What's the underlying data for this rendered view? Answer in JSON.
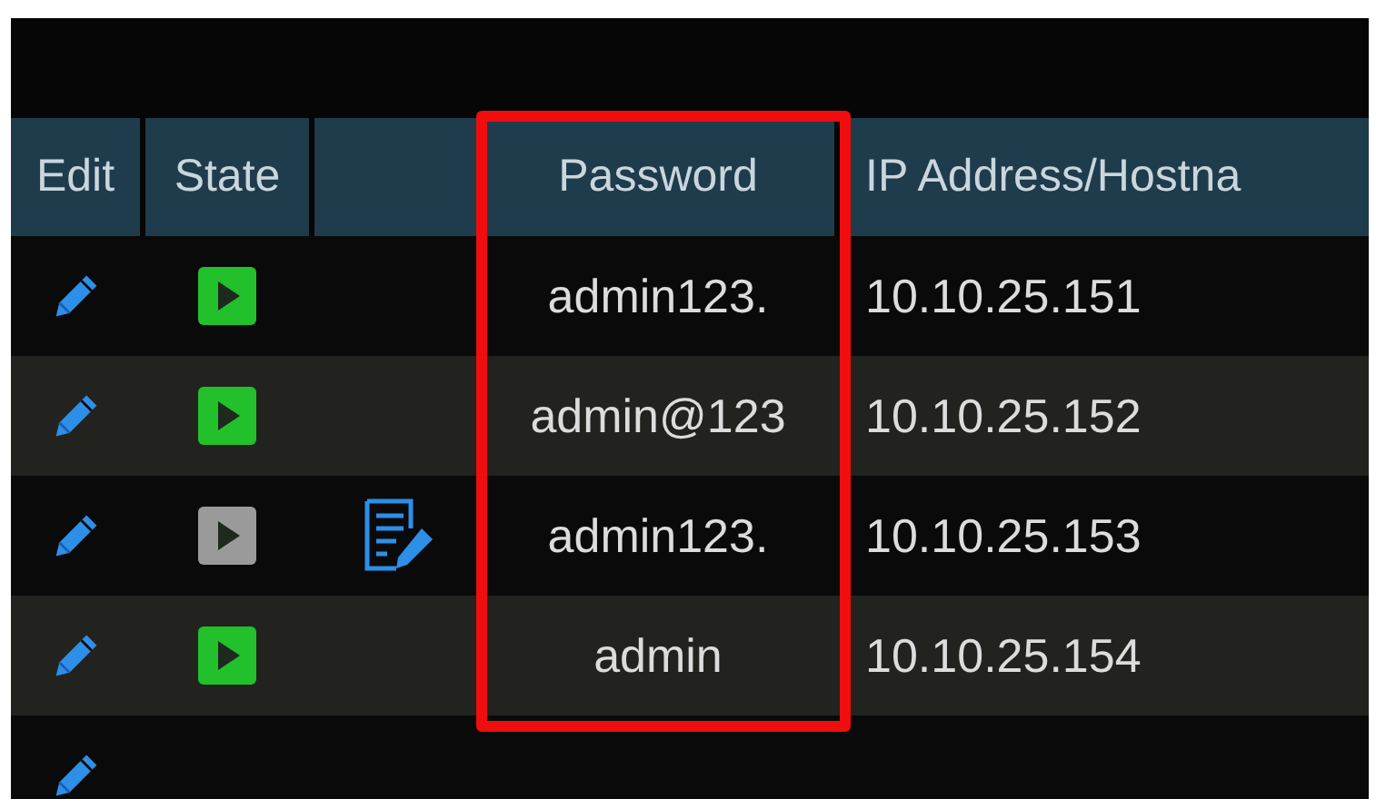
{
  "table": {
    "columns": [
      {
        "label": "Edit",
        "highlighted": false
      },
      {
        "label": "State",
        "highlighted": false
      },
      {
        "highlighted": false
      },
      {
        "label": "Password",
        "highlighted": true
      },
      {
        "label": "IP Address/Hostna",
        "highlighted": false
      }
    ],
    "rows": [
      {
        "kind": "device",
        "online": true,
        "note": false,
        "password": "admin123.",
        "address": "10.10.25.151"
      },
      {
        "kind": "device",
        "online": true,
        "note": false,
        "password": "admin@123",
        "address": "10.10.25.152"
      },
      {
        "kind": "device",
        "online": false,
        "note": true,
        "password": "admin123.",
        "address": "10.10.25.153"
      },
      {
        "kind": "device",
        "online": true,
        "note": false,
        "password": "admin",
        "address": "10.10.25.154"
      },
      {
        "kind": "empty"
      }
    ]
  }
}
